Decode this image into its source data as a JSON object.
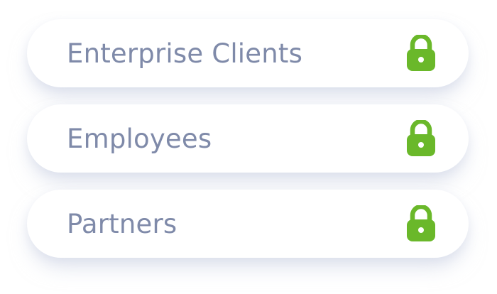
{
  "colors": {
    "label_text": "#7f8aa9",
    "lock_icon": "#6ab82a",
    "background": "#ffffff"
  },
  "items": [
    {
      "label": "Enterprise Clients",
      "icon": "lock-icon"
    },
    {
      "label": "Employees",
      "icon": "lock-icon"
    },
    {
      "label": "Partners",
      "icon": "lock-icon"
    }
  ]
}
